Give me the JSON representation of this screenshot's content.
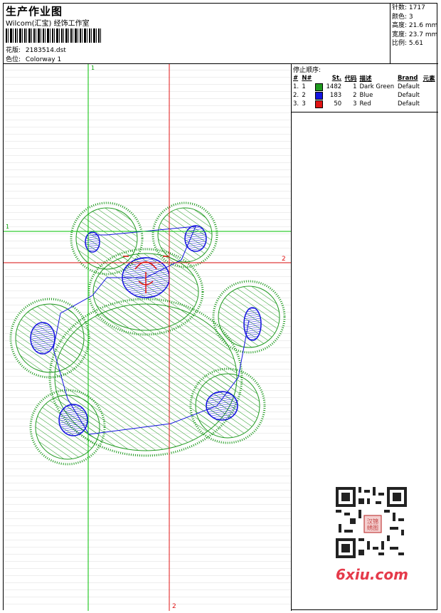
{
  "header": {
    "title": "生产作业图",
    "subtitle": "Wilcom(汇宝) 经饰工作室",
    "design_label": "花版:",
    "design_file": "2183514.dst",
    "color_label": "色位:",
    "colorway": "Colorway 1"
  },
  "stats": {
    "stitches_label": "针数:",
    "stitches": "1717",
    "colors_label": "颜色:",
    "colors": "3",
    "height_label": "高度:",
    "height": "21.6 mm",
    "width_label": "宽度:",
    "width": "23.7 mm",
    "ratio_label": "比例:",
    "ratio": "5.61"
  },
  "guides": {
    "green_v_label": "1",
    "green_h_label": "1",
    "red_h_label": "2",
    "red_v_label": "2"
  },
  "stop_sequence": {
    "title": "停止顺序:",
    "headers": [
      "#",
      "N#",
      "St.",
      "代码",
      "描述",
      "Brand",
      "元素"
    ],
    "rows": [
      {
        "num": "1.",
        "n": "1",
        "color": "#1f9a1f",
        "stitches": "1482",
        "code": "1",
        "desc": "Dark Green",
        "brand": "Default",
        "element": ""
      },
      {
        "num": "2.",
        "n": "2",
        "color": "#1414e0",
        "stitches": "183",
        "code": "2",
        "desc": "Blue",
        "brand": "Default",
        "element": ""
      },
      {
        "num": "3.",
        "n": "3",
        "color": "#e01414",
        "stitches": "50",
        "code": "3",
        "desc": "Red",
        "brand": "Default",
        "element": ""
      }
    ]
  },
  "watermark": "6xiu.com",
  "qr_seal": "汉锦 绣图"
}
